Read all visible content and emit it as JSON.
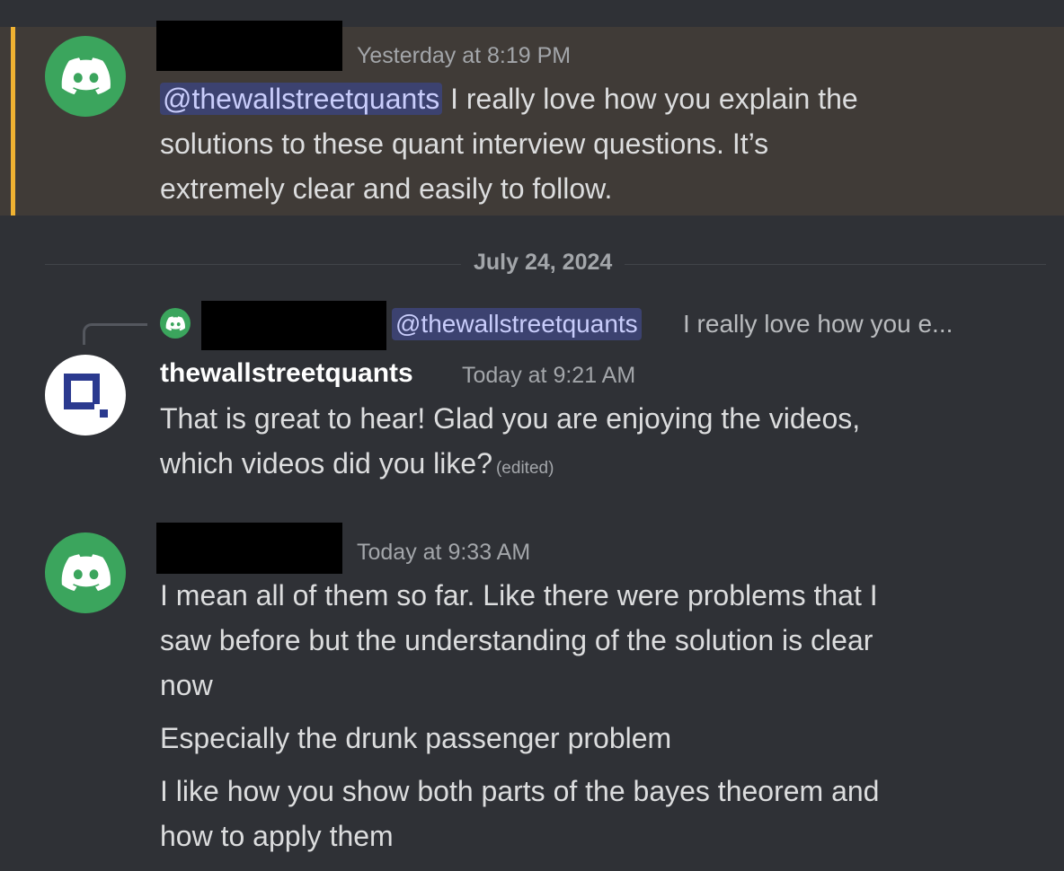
{
  "messages": [
    {
      "timestamp": "Yesterday at 8:19 PM",
      "mention": "@thewallstreetquants",
      "lines": [
        " I really love how you explain the",
        "solutions to these quant interview questions. It’s",
        "extremely clear and easily to follow."
      ]
    },
    {
      "reply": {
        "mention": "@thewallstreetquants",
        "preview": "I really love how you e..."
      },
      "author": "thewallstreetquants",
      "timestamp": "Today at 9:21 AM",
      "lines": [
        "That is great to hear! Glad you are enjoying the videos,",
        "which videos did you like?"
      ],
      "edited_label": "(edited)"
    },
    {
      "timestamp": "Today at 9:33 AM",
      "lines": [
        "I mean all of them so far. Like there were problems that I",
        "saw before but the understanding of the solution is clear",
        "now",
        "Especially the drunk passenger problem",
        "I like how you show both parts of the bayes theorem and",
        "how to apply them"
      ]
    }
  ],
  "date_divider": "July 24, 2024",
  "colors": {
    "background": "#2f3136",
    "highlight_background": "#403b37",
    "highlight_bar": "#f0b232",
    "discord_avatar": "#3ba55d",
    "mention_background": "#3c4270",
    "mention_text": "#c9cdfb",
    "wsq_logo": "#2b3a8f"
  },
  "icons": {
    "discord_avatar": "discord-logo-icon",
    "wsq_avatar": "wallstreetquants-logo-icon"
  }
}
